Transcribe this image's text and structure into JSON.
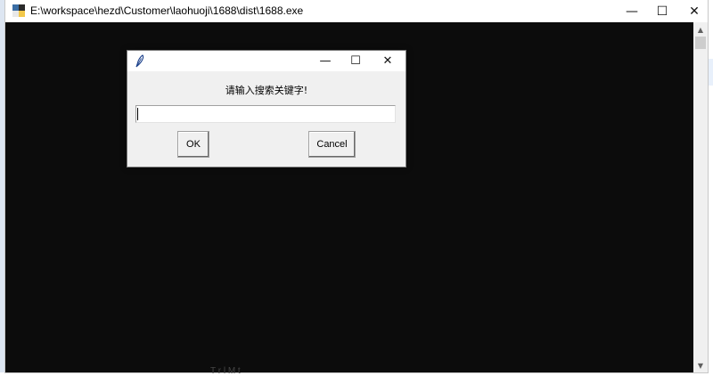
{
  "console_window": {
    "title": "E:\\workspace\\hezd\\Customer\\laohuoji\\1688\\dist\\1688.exe",
    "minimize_glyph": "—",
    "maximize_glyph": "☐",
    "close_glyph": "✕",
    "scroll_up_glyph": "▲",
    "scroll_down_glyph": "▼"
  },
  "dialog": {
    "prompt": "请输入搜索关键字!",
    "input_value": "",
    "ok_label": "OK",
    "cancel_label": "Cancel",
    "minimize_glyph": "—",
    "maximize_glyph": "☐",
    "close_glyph": "✕"
  },
  "background": {
    "bottom_text": "T    r  l  M  t"
  },
  "colors": {
    "console_bg": "#0c0c0c",
    "dialog_bg": "#f0f0f0",
    "titlebar_bg": "#ffffff"
  }
}
